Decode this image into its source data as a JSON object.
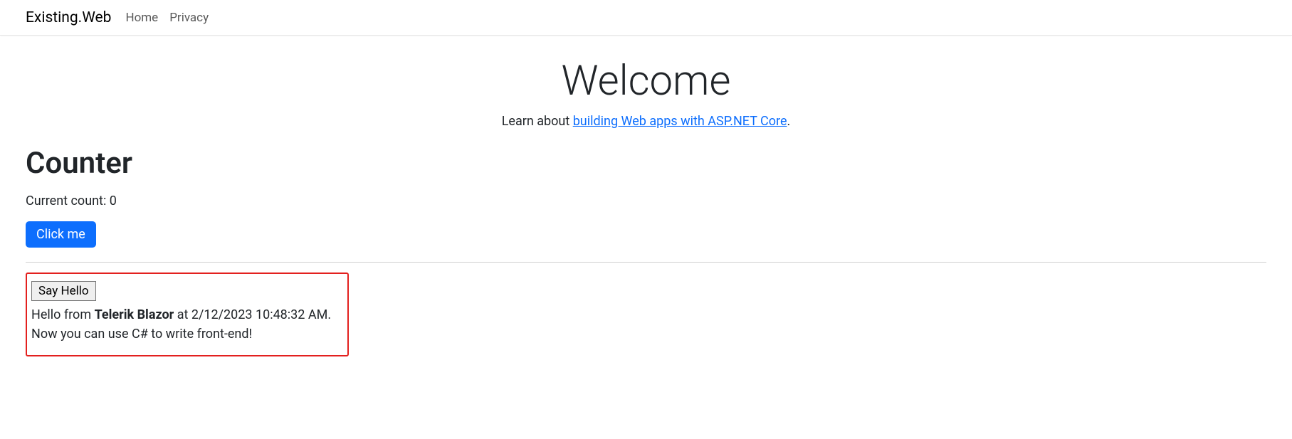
{
  "navbar": {
    "brand": "Existing.Web",
    "links": {
      "home": "Home",
      "privacy": "Privacy"
    }
  },
  "welcome": {
    "title": "Welcome",
    "subtitle_prefix": "Learn about ",
    "subtitle_link": "building Web apps with ASP.NET Core",
    "subtitle_suffix": "."
  },
  "counter": {
    "heading": "Counter",
    "current_label": "Current count: ",
    "current_value": "0",
    "button_label": "Click me"
  },
  "hello": {
    "button_label": "Say Hello",
    "greeting_prefix": "Hello from ",
    "greeting_strong": "Telerik Blazor",
    "greeting_middle": " at ",
    "greeting_timestamp": "2/12/2023 10:48:32 AM",
    "greeting_suffix": ".",
    "line2": "Now you can use C# to write front-end!"
  }
}
